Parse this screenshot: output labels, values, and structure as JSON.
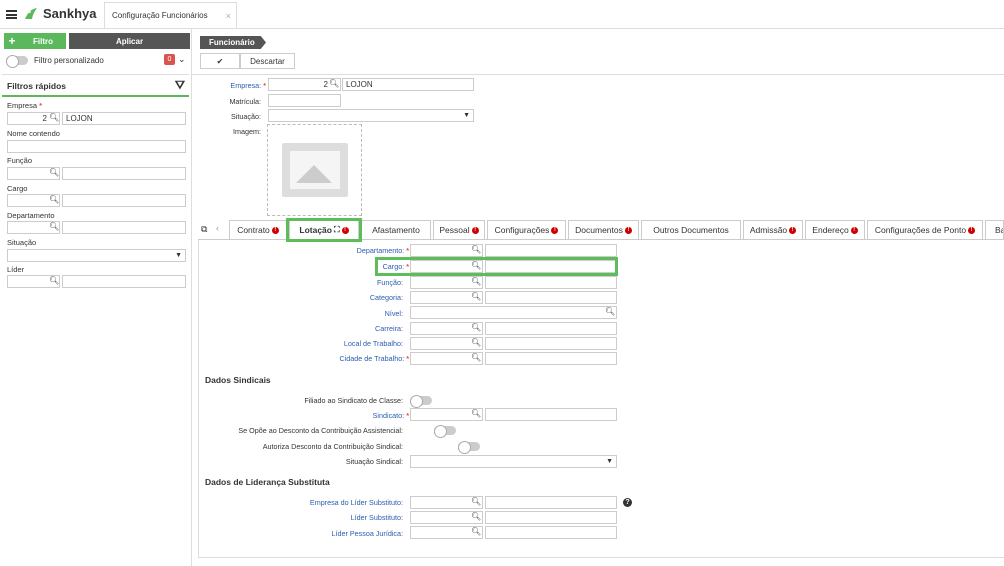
{
  "app": {
    "brand": "Sankhya",
    "doc_tab": "Configuração Funcionários",
    "close": "×"
  },
  "left": {
    "filtro": "Filtro",
    "aplicar": "Aplicar",
    "filtro_personalizado": "Filtro personalizado",
    "badge_count": "0",
    "filtros_rapidos": "Filtros rápidos",
    "empresa_label": "Empresa",
    "empresa_code": "2",
    "empresa_name": "LOJON",
    "nome_label": "Nome contendo",
    "funcao_label": "Função",
    "cargo_label": "Cargo",
    "departamento_label": "Departamento",
    "situacao_label": "Situação",
    "lider_label": "Líder"
  },
  "toolbar": {
    "breadcrumb": "Funcionário",
    "descartar": "Descartar"
  },
  "form": {
    "empresa_label": "Empresa:",
    "empresa_code": "2",
    "empresa_name": "LOJON",
    "matricula_label": "Matrícula:",
    "situacao_label": "Situação:",
    "imagem_label": "Imagem:"
  },
  "tabs": [
    {
      "label": "Contrato",
      "err": true
    },
    {
      "label": "Lotação",
      "err": true
    },
    {
      "label": "Afastamento",
      "err": false
    },
    {
      "label": "Pessoal",
      "err": true
    },
    {
      "label": "Configurações",
      "err": true
    },
    {
      "label": "Documentos",
      "err": true
    },
    {
      "label": "Outros Documentos",
      "err": false
    },
    {
      "label": "Admissão",
      "err": true
    },
    {
      "label": "Endereço",
      "err": true
    },
    {
      "label": "Configurações de Ponto",
      "err": true
    },
    {
      "label": "Ba",
      "err": false
    }
  ],
  "lotacao": {
    "departamento": "Departamento:",
    "cargo": "Cargo:",
    "funcao": "Função:",
    "categoria": "Categoria:",
    "nivel": "Nível:",
    "carreira": "Carreira:",
    "local": "Local de Trabalho:",
    "cidade": "Cidade de Trabalho:"
  },
  "sindicais": {
    "title": "Dados Sindicais",
    "filiado": "Filiado ao Sindicato de Classe:",
    "sindicato": "Sindicato:",
    "opoe": "Se Opõe ao Desconto da Contribuição Assistencial:",
    "autoriza": "Autoriza Desconto da Contribuição Sindical:",
    "situacao": "Situação Sindical:"
  },
  "lideranca": {
    "title": "Dados de Liderança Substituta",
    "empresa": "Empresa do Líder Substituto:",
    "lider": "Líder Substituto:",
    "pj": "Líder Pessoa Jurídica:"
  },
  "colors": {
    "accent": "#5cb85c",
    "dark": "#555555",
    "link": "#2a5db0",
    "error": "#cc0000"
  }
}
